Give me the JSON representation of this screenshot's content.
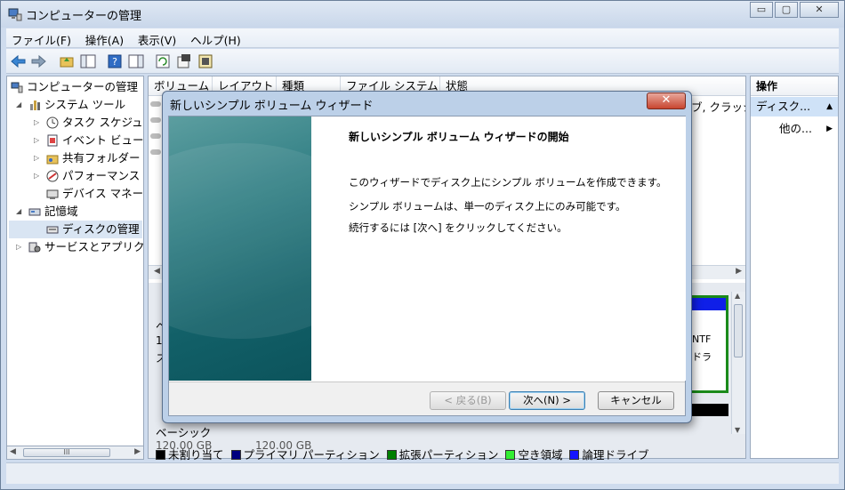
{
  "app": {
    "title": "コンピューターの管理"
  },
  "window_buttons": {
    "minimize": "▭",
    "maximize": "▢",
    "close": "✕"
  },
  "menus": [
    "ファイル(F)",
    "操作(A)",
    "表示(V)",
    "ヘルプ(H)"
  ],
  "tree": [
    {
      "label": "コンピューターの管理",
      "level": 0,
      "expander": ""
    },
    {
      "label": "システム ツール",
      "level": 1,
      "expander": "◢"
    },
    {
      "label": "タスク スケジュ",
      "level": 2,
      "expander": "▷"
    },
    {
      "label": "イベント ビュー",
      "level": 2,
      "expander": "▷"
    },
    {
      "label": "共有フォルダー",
      "level": 2,
      "expander": "▷"
    },
    {
      "label": "パフォーマンス",
      "level": 2,
      "expander": "▷"
    },
    {
      "label": "デバイス マネー",
      "level": 2,
      "expander": ""
    },
    {
      "label": "記憶域",
      "level": 1,
      "expander": "◢"
    },
    {
      "label": "ディスクの管理",
      "level": 2,
      "expander": ""
    },
    {
      "label": "サービスとアプリク",
      "level": 1,
      "expander": "▷"
    }
  ],
  "tree_scroll": {
    "thumb": "III"
  },
  "columns": [
    "ボリューム",
    "レイアウト",
    "種類",
    "ファイル システム",
    "状態"
  ],
  "row_text": "ブ, クラッシ",
  "disk_partial": {
    "label_a": "ヘ",
    "label_b": "1",
    "label_c": "ス",
    "fs": "NTF",
    "status": "ドラ",
    "bottom_label": "ベーシック",
    "bottom_size": "120.00 GB",
    "bottom_size2": "120.00 GB"
  },
  "legend": [
    {
      "label": "未割り当て",
      "color": "#000000"
    },
    {
      "label": "プライマリ パーティション",
      "color": "#00007f"
    },
    {
      "label": "拡張パーティション",
      "color": "#007f00"
    },
    {
      "label": "空き領域",
      "color": "#33ee33"
    },
    {
      "label": "論理ドライブ",
      "color": "#1515ff"
    }
  ],
  "actions": {
    "header": "操作",
    "selected": "ディスク...",
    "more": "他の..."
  },
  "wizard": {
    "title": "新しいシンプル ボリューム ウィザード",
    "heading": "新しいシンプル ボリューム ウィザードの開始",
    "paragraphs": [
      "このウィザードでディスク上にシンプル ボリュームを作成できます。",
      "シンプル ボリュームは、単一のディスク上にのみ可能です。",
      "続行するには [次へ] をクリックしてください。"
    ],
    "buttons": {
      "back": "< 戻る(B)",
      "next": "次へ(N) >",
      "cancel": "キャンセル"
    },
    "close": "✕"
  }
}
